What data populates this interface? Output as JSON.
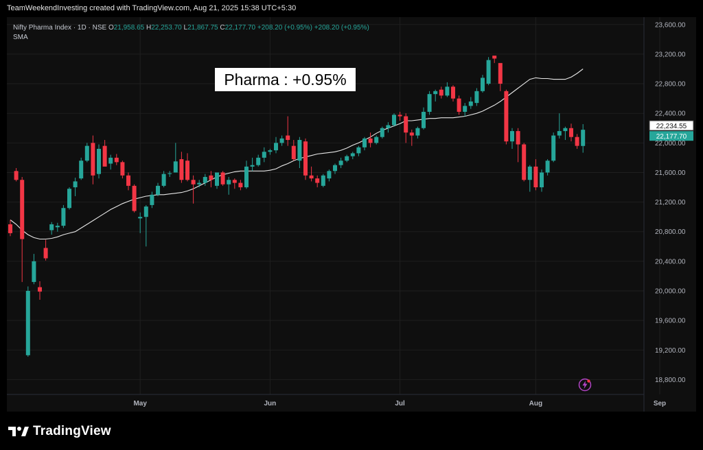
{
  "caption": "TeamWeekendInvesting created with TradingView.com, Aug 21, 2025 15:38 UTC+5:30",
  "legend": {
    "symbol": "Nifty Pharma Index · 1D · NSE",
    "o_label": "O",
    "o_value": "21,958.65",
    "h_label": "H",
    "h_value": "22,253.70",
    "l_label": "L",
    "l_value": "21,867.75",
    "c_label": "C",
    "c_value": "22,177.70",
    "change": "+208.20 (+0.95%)",
    "change2": "+208.20 (+0.95%)",
    "indicator": "SMA"
  },
  "annotation": "Pharma : +0.95%",
  "brand": "TradingView",
  "colors": {
    "up": "#26a69a",
    "down": "#f23645",
    "sma": "#e8e8e8",
    "background": "#0f0f0f",
    "grid": "#1f1f1f",
    "axis_text": "#b2b5be",
    "last_price_bg": "#26a69a"
  },
  "chart_data": {
    "type": "candlestick",
    "title": "Nifty Pharma Index · 1D · NSE",
    "ylim": [
      18600,
      23700
    ],
    "y_ticks": [
      18800,
      19200,
      19600,
      20000,
      20400,
      20800,
      21200,
      21600,
      22000,
      22400,
      22800,
      23200,
      23600
    ],
    "y_tick_labels": [
      "18,800.00",
      "19,200.00",
      "19,600.00",
      "20,000.00",
      "20,400.00",
      "20,800.00",
      "21,200.00",
      "21,600.00",
      "22,000.00",
      "22,400.00",
      "22,800.00",
      "23,200.00",
      "23,600.00"
    ],
    "x_month_labels": [
      {
        "label": "May",
        "index": 22
      },
      {
        "label": "Jun",
        "index": 44
      },
      {
        "label": "Jul",
        "index": 66
      },
      {
        "label": "Aug",
        "index": 89
      },
      {
        "label": "Sep",
        "index": 110
      }
    ],
    "grid": true,
    "sma_label": "SMA",
    "sma_value": "22,234.55",
    "last_price": "22,177.70",
    "candles": [
      {
        "o": 20900,
        "h": 20960,
        "l": 20740,
        "c": 20780
      },
      {
        "o": 21620,
        "h": 21660,
        "l": 21480,
        "c": 21500
      },
      {
        "o": 21500,
        "h": 21540,
        "l": 20120,
        "c": 20700
      },
      {
        "o": 19130,
        "h": 20060,
        "l": 19110,
        "c": 20000
      },
      {
        "o": 20120,
        "h": 20500,
        "l": 20090,
        "c": 20400
      },
      {
        "o": 20050,
        "h": 20130,
        "l": 19880,
        "c": 19990
      },
      {
        "o": 20580,
        "h": 20690,
        "l": 20410,
        "c": 20440
      },
      {
        "o": 20820,
        "h": 20930,
        "l": 20760,
        "c": 20900
      },
      {
        "o": 20860,
        "h": 20920,
        "l": 20800,
        "c": 20880
      },
      {
        "o": 20880,
        "h": 21160,
        "l": 20850,
        "c": 21120
      },
      {
        "o": 21120,
        "h": 21400,
        "l": 21100,
        "c": 21380
      },
      {
        "o": 21400,
        "h": 21530,
        "l": 21280,
        "c": 21480
      },
      {
        "o": 21520,
        "h": 21800,
        "l": 21500,
        "c": 21760
      },
      {
        "o": 21760,
        "h": 22000,
        "l": 21740,
        "c": 21960
      },
      {
        "o": 22000,
        "h": 22100,
        "l": 21440,
        "c": 21560
      },
      {
        "o": 21580,
        "h": 21980,
        "l": 21520,
        "c": 21920
      },
      {
        "o": 21960,
        "h": 22040,
        "l": 21880,
        "c": 21680
      },
      {
        "o": 21720,
        "h": 21840,
        "l": 21640,
        "c": 21800
      },
      {
        "o": 21800,
        "h": 21850,
        "l": 21700,
        "c": 21740
      },
      {
        "o": 21740,
        "h": 21760,
        "l": 21520,
        "c": 21560
      },
      {
        "o": 21560,
        "h": 21600,
        "l": 21360,
        "c": 21420
      },
      {
        "o": 21420,
        "h": 21440,
        "l": 21060,
        "c": 21080
      },
      {
        "o": 20980,
        "h": 21060,
        "l": 20780,
        "c": 21000
      },
      {
        "o": 21000,
        "h": 21160,
        "l": 20600,
        "c": 21140
      },
      {
        "o": 21160,
        "h": 21340,
        "l": 21120,
        "c": 21300
      },
      {
        "o": 21300,
        "h": 21460,
        "l": 21280,
        "c": 21420
      },
      {
        "o": 21420,
        "h": 21620,
        "l": 21400,
        "c": 21580
      },
      {
        "o": 21580,
        "h": 21620,
        "l": 21540,
        "c": 21590
      },
      {
        "o": 21600,
        "h": 22000,
        "l": 21600,
        "c": 21750
      },
      {
        "o": 21780,
        "h": 21880,
        "l": 21460,
        "c": 21500
      },
      {
        "o": 21760,
        "h": 21860,
        "l": 21480,
        "c": 21500
      },
      {
        "o": 21500,
        "h": 21560,
        "l": 21180,
        "c": 21440
      },
      {
        "o": 21440,
        "h": 21500,
        "l": 21400,
        "c": 21460
      },
      {
        "o": 21460,
        "h": 21580,
        "l": 21420,
        "c": 21540
      },
      {
        "o": 21560,
        "h": 21620,
        "l": 21400,
        "c": 21500
      },
      {
        "o": 21420,
        "h": 21600,
        "l": 21380,
        "c": 21600
      },
      {
        "o": 21600,
        "h": 21620,
        "l": 21420,
        "c": 21440
      },
      {
        "o": 21440,
        "h": 21540,
        "l": 21300,
        "c": 21500
      },
      {
        "o": 21500,
        "h": 21520,
        "l": 21380,
        "c": 21460
      },
      {
        "o": 21460,
        "h": 21500,
        "l": 21360,
        "c": 21400
      },
      {
        "o": 21400,
        "h": 21760,
        "l": 21380,
        "c": 21680
      },
      {
        "o": 21680,
        "h": 21800,
        "l": 21620,
        "c": 21700
      },
      {
        "o": 21700,
        "h": 21840,
        "l": 21680,
        "c": 21800
      },
      {
        "o": 21800,
        "h": 21940,
        "l": 21740,
        "c": 21880
      },
      {
        "o": 21880,
        "h": 21920,
        "l": 21840,
        "c": 21900
      },
      {
        "o": 21900,
        "h": 22080,
        "l": 21860,
        "c": 22000
      },
      {
        "o": 22000,
        "h": 22100,
        "l": 21960,
        "c": 22060
      },
      {
        "o": 22100,
        "h": 22360,
        "l": 21960,
        "c": 22040
      },
      {
        "o": 21960,
        "h": 22040,
        "l": 21760,
        "c": 21780
      },
      {
        "o": 21760,
        "h": 22080,
        "l": 21660,
        "c": 22040
      },
      {
        "o": 22020,
        "h": 22060,
        "l": 21500,
        "c": 21560
      },
      {
        "o": 21560,
        "h": 21680,
        "l": 21480,
        "c": 21520
      },
      {
        "o": 21520,
        "h": 21560,
        "l": 21400,
        "c": 21460
      },
      {
        "o": 21420,
        "h": 21580,
        "l": 21400,
        "c": 21560
      },
      {
        "o": 21520,
        "h": 21640,
        "l": 21480,
        "c": 21620
      },
      {
        "o": 21620,
        "h": 21720,
        "l": 21580,
        "c": 21700
      },
      {
        "o": 21700,
        "h": 21800,
        "l": 21660,
        "c": 21760
      },
      {
        "o": 21760,
        "h": 21840,
        "l": 21740,
        "c": 21820
      },
      {
        "o": 21820,
        "h": 21880,
        "l": 21780,
        "c": 21860
      },
      {
        "o": 21860,
        "h": 21960,
        "l": 21820,
        "c": 21940
      },
      {
        "o": 21940,
        "h": 22080,
        "l": 21900,
        "c": 22060
      },
      {
        "o": 22060,
        "h": 22140,
        "l": 21940,
        "c": 22000
      },
      {
        "o": 22000,
        "h": 22100,
        "l": 21980,
        "c": 22080
      },
      {
        "o": 22080,
        "h": 22220,
        "l": 22060,
        "c": 22200
      },
      {
        "o": 22200,
        "h": 22280,
        "l": 22140,
        "c": 22240
      },
      {
        "o": 22240,
        "h": 22400,
        "l": 22220,
        "c": 22380
      },
      {
        "o": 22380,
        "h": 22420,
        "l": 22300,
        "c": 22360
      },
      {
        "o": 22360,
        "h": 22400,
        "l": 22000,
        "c": 22140
      },
      {
        "o": 22140,
        "h": 22180,
        "l": 21960,
        "c": 22100
      },
      {
        "o": 22100,
        "h": 22220,
        "l": 22060,
        "c": 22200
      },
      {
        "o": 22200,
        "h": 22480,
        "l": 22180,
        "c": 22420
      },
      {
        "o": 22420,
        "h": 22700,
        "l": 22380,
        "c": 22660
      },
      {
        "o": 22660,
        "h": 22720,
        "l": 22560,
        "c": 22700
      },
      {
        "o": 22720,
        "h": 22760,
        "l": 22600,
        "c": 22640
      },
      {
        "o": 22640,
        "h": 22820,
        "l": 22620,
        "c": 22760
      },
      {
        "o": 22760,
        "h": 22780,
        "l": 22560,
        "c": 22600
      },
      {
        "o": 22600,
        "h": 22640,
        "l": 22380,
        "c": 22420
      },
      {
        "o": 22420,
        "h": 22540,
        "l": 22360,
        "c": 22500
      },
      {
        "o": 22500,
        "h": 22620,
        "l": 22460,
        "c": 22560
      },
      {
        "o": 22540,
        "h": 22740,
        "l": 22500,
        "c": 22700
      },
      {
        "o": 22700,
        "h": 22920,
        "l": 22680,
        "c": 22880
      },
      {
        "o": 22800,
        "h": 23160,
        "l": 22780,
        "c": 23120
      },
      {
        "o": 23180,
        "h": 23160,
        "l": 23080,
        "c": 23140
      },
      {
        "o": 23080,
        "h": 23000,
        "l": 22700,
        "c": 22800
      },
      {
        "o": 22700,
        "h": 22720,
        "l": 21980,
        "c": 22020
      },
      {
        "o": 22020,
        "h": 22200,
        "l": 21920,
        "c": 22160
      },
      {
        "o": 22160,
        "h": 22200,
        "l": 21740,
        "c": 21980
      },
      {
        "o": 21980,
        "h": 22000,
        "l": 21480,
        "c": 21500
      },
      {
        "o": 21500,
        "h": 21700,
        "l": 21340,
        "c": 21680
      },
      {
        "o": 21680,
        "h": 21780,
        "l": 21360,
        "c": 21400
      },
      {
        "o": 21400,
        "h": 21640,
        "l": 21340,
        "c": 21600
      },
      {
        "o": 21600,
        "h": 21780,
        "l": 21560,
        "c": 21760
      },
      {
        "o": 21760,
        "h": 22140,
        "l": 21740,
        "c": 22100
      },
      {
        "o": 22100,
        "h": 22400,
        "l": 22060,
        "c": 22160
      },
      {
        "o": 22160,
        "h": 22220,
        "l": 22040,
        "c": 22200
      },
      {
        "o": 22200,
        "h": 22260,
        "l": 22020,
        "c": 22080
      },
      {
        "o": 22080,
        "h": 22120,
        "l": 21920,
        "c": 21960
      },
      {
        "o": 21958.65,
        "h": 22253.7,
        "l": 21867.75,
        "c": 22177.7
      }
    ],
    "sma": [
      20960,
      20900,
      20820,
      20760,
      20720,
      20700,
      20700,
      20710,
      20730,
      20760,
      20780,
      20800,
      20850,
      20900,
      20950,
      21000,
      21050,
      21100,
      21140,
      21180,
      21210,
      21240,
      21260,
      21280,
      21290,
      21300,
      21300,
      21310,
      21320,
      21330,
      21350,
      21380,
      21420,
      21460,
      21500,
      21540,
      21570,
      21590,
      21610,
      21620,
      21620,
      21620,
      21620,
      21620,
      21630,
      21650,
      21690,
      21720,
      21760,
      21790,
      21810,
      21830,
      21850,
      21860,
      21870,
      21880,
      21900,
      21930,
      21970,
      22000,
      22040,
      22080,
      22130,
      22170,
      22200,
      22230,
      22260,
      22300,
      22300,
      22310,
      22320,
      22330,
      22330,
      22340,
      22340,
      22340,
      22350,
      22360,
      22380,
      22400,
      22430,
      22470,
      22510,
      22560,
      22620,
      22680,
      22740,
      22800,
      22860,
      22880,
      22870,
      22870,
      22860,
      22860,
      22860,
      22890,
      22940,
      23000
    ]
  }
}
